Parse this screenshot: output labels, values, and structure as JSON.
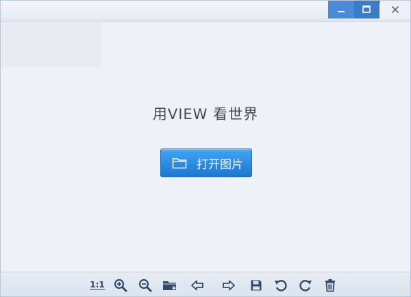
{
  "window": {
    "controls": [
      "minimize-icon",
      "maximize-icon",
      "close-icon"
    ]
  },
  "main": {
    "slogan": "用VIEW 看世界",
    "open_button": {
      "label": "打开图片",
      "icon": "folder-icon"
    }
  },
  "toolbar": {
    "actual_size_label": "1:1",
    "tools": [
      "actual-size",
      "zoom-in-icon",
      "zoom-out-icon",
      "open-folder-icon",
      "previous-icon",
      "next-icon",
      "save-icon",
      "rotate-left-icon",
      "rotate-right-icon",
      "delete-icon"
    ]
  },
  "colors": {
    "accent": "#2b8ae3",
    "title_accent": "#3e84d6",
    "icon": "#2f4a6e",
    "background": "#eef1f7"
  }
}
